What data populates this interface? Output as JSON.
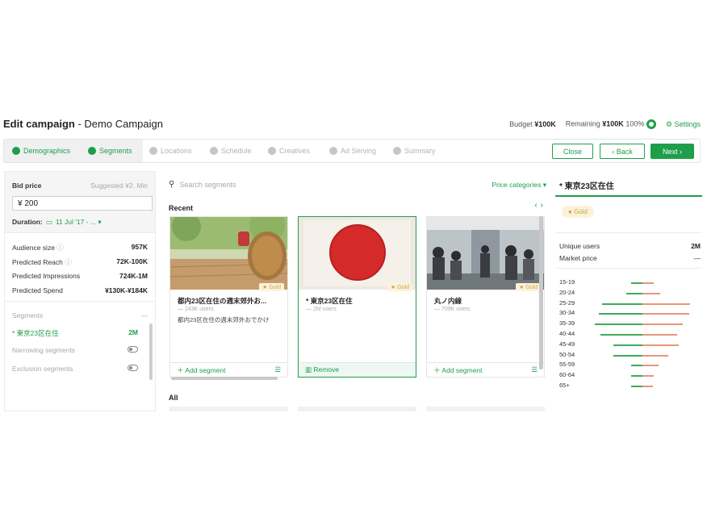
{
  "header": {
    "title_bold": "Edit campaign",
    "title_sep": " - ",
    "campaign_name": "Demo Campaign",
    "budget_label": "Budget",
    "budget_value": "¥100K",
    "remaining_label": "Remaining",
    "remaining_value": "¥100K",
    "remaining_pct": "100%",
    "settings_label": "Settings"
  },
  "steps": [
    {
      "label": "Demographics",
      "state": "active"
    },
    {
      "label": "Segments",
      "state": "active"
    },
    {
      "label": "Locations",
      "state": "inactive"
    },
    {
      "label": "Schedule",
      "state": "inactive"
    },
    {
      "label": "Creatives",
      "state": "inactive"
    },
    {
      "label": "Ad Serving",
      "state": "inactive"
    },
    {
      "label": "Summary",
      "state": "inactive"
    }
  ],
  "actions": {
    "close": "Close",
    "back": "‹ Back",
    "next": "Next ›"
  },
  "bid": {
    "label": "Bid price",
    "suggested": "Suggested ¥2. Min",
    "value": "¥ 200",
    "duration_label": "Duration:",
    "duration_value": "11 Jul '17 - ..."
  },
  "stats": [
    {
      "label": "Audience size",
      "value": "957K"
    },
    {
      "label": "Predicted Reach",
      "value": "72K-100K"
    },
    {
      "label": "Predicted Impressions",
      "value": "724K-1M"
    },
    {
      "label": "Predicted Spend",
      "value": "¥130K-¥184K"
    }
  ],
  "segments_panel": {
    "header": "Segments",
    "selected_label": "* 東京23区在住",
    "selected_value": "2M",
    "narrowing": "Narrowing segments",
    "exclusion": "Exclusion segments"
  },
  "search": {
    "placeholder": "Search segments",
    "price_categories": "Price categories"
  },
  "recent_label": "Recent",
  "all_label": "All",
  "cards": [
    {
      "title": "都内23区在住の週末郊外お...",
      "sub": "— 243K users",
      "desc": "都内23区在住の週末郊外おでかけ",
      "tag": "Gold",
      "action": "Add segment",
      "selected": false
    },
    {
      "title": "* 東京23区在住",
      "sub": "— 2M users",
      "desc": "",
      "tag": "Gold",
      "action": "Remove",
      "selected": true
    },
    {
      "title": "丸ノ内線",
      "sub": "— 709K users",
      "desc": "",
      "tag": "Gold",
      "action": "Add segment",
      "selected": false
    }
  ],
  "detail": {
    "title": "* 東京23区在住",
    "tag": "Gold",
    "unique_users_label": "Unique users",
    "unique_users_value": "2M",
    "market_price_label": "Market price",
    "market_price_value": "—"
  },
  "age_chart": {
    "categories": [
      "15-19",
      "20-24",
      "25-29",
      "30-34",
      "35-39",
      "40-44",
      "45-49",
      "50-54",
      "55-59",
      "60-64",
      "65+"
    ],
    "male": [
      0.2,
      0.28,
      0.7,
      0.75,
      0.82,
      0.72,
      0.5,
      0.5,
      0.2,
      0.2,
      0.2
    ],
    "female": [
      0.2,
      0.3,
      0.82,
      0.8,
      0.7,
      0.6,
      0.62,
      0.45,
      0.28,
      0.2,
      0.18
    ]
  },
  "colors": {
    "accent": "#1e9e49",
    "male_bar": "#3daa5c",
    "female_bar": "#e8967a",
    "gold_tag_bg": "#fcf2da"
  }
}
